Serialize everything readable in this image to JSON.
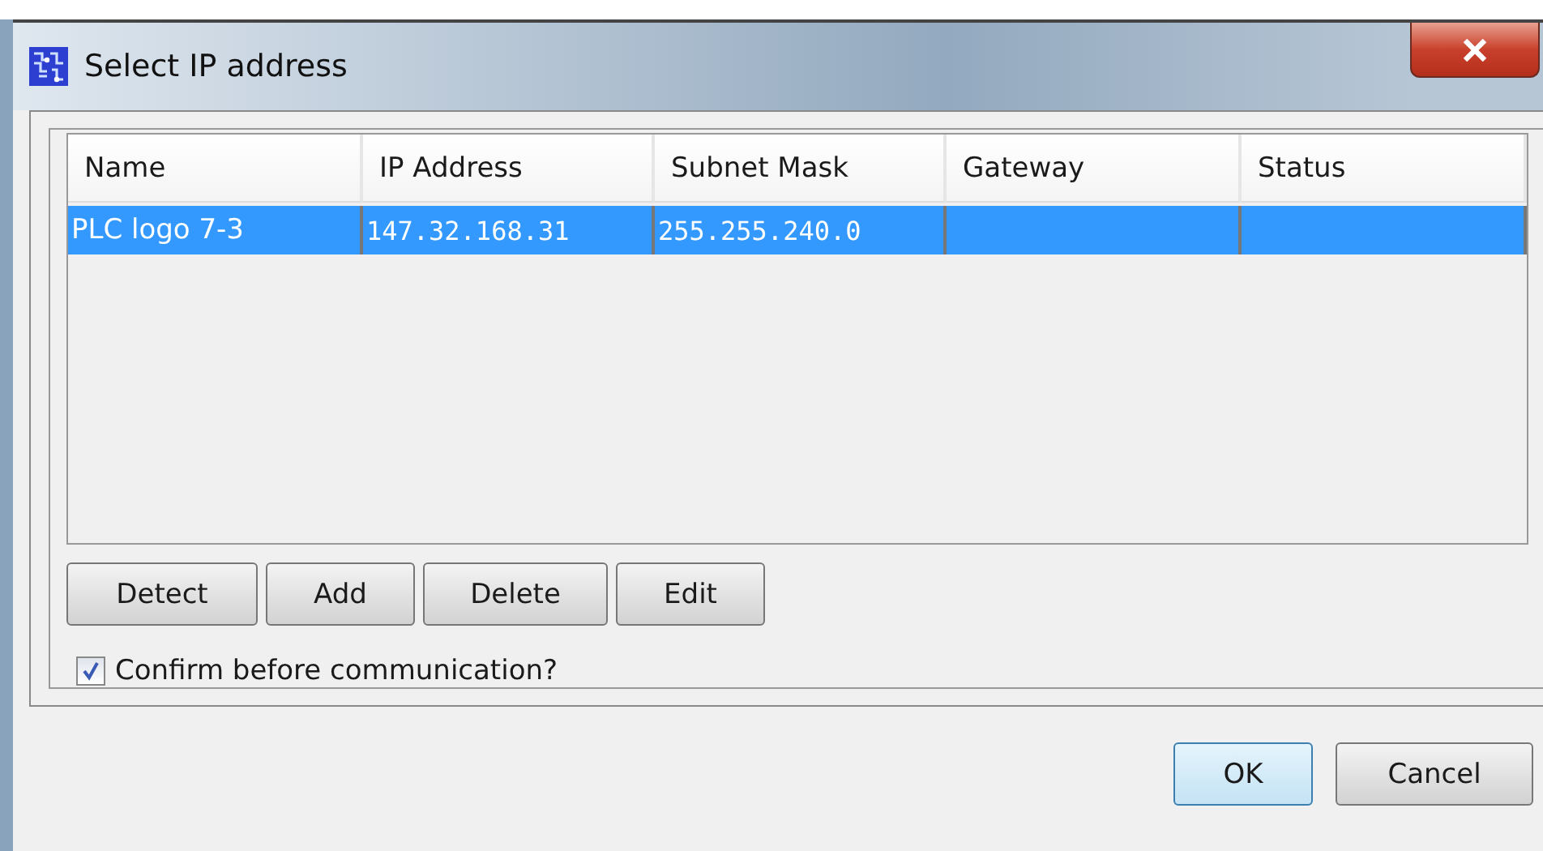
{
  "window": {
    "title": "Select IP address"
  },
  "table": {
    "columns": [
      "Name",
      "IP Address",
      "Subnet Mask",
      "Gateway",
      "Status"
    ],
    "rows": [
      {
        "cells": [
          "PLC logo 7-3",
          "147.32.168.31",
          "255.255.240.0",
          "",
          ""
        ],
        "selected": true
      }
    ]
  },
  "actions": [
    "Detect",
    "Add",
    "Delete",
    "Edit"
  ],
  "confirm": {
    "label": "Confirm before communication?",
    "checked": true
  },
  "buttons": [
    {
      "label": "OK",
      "default": true
    },
    {
      "label": "Cancel",
      "default": false
    }
  ]
}
